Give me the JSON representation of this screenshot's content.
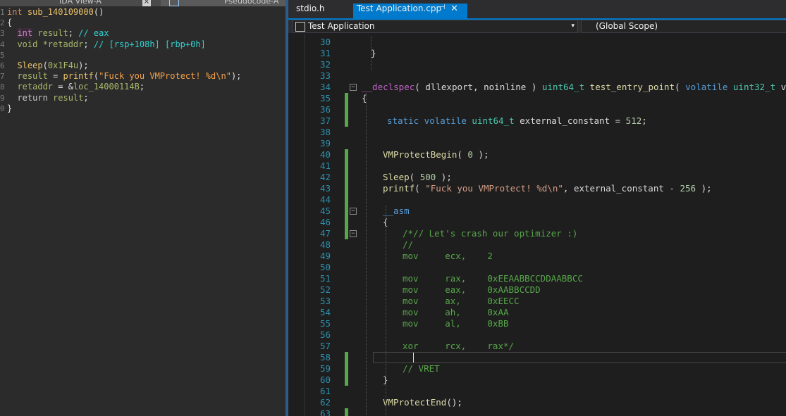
{
  "ida": {
    "tab1_label": "IDA View-A",
    "tab2_label": "Pseudocode-A",
    "close_glyph": "×",
    "lines": [
      {
        "n": "1"
      },
      {
        "n": "2"
      },
      {
        "n": "3"
      },
      {
        "n": "4"
      },
      {
        "n": "5"
      },
      {
        "n": "6"
      },
      {
        "n": "7"
      },
      {
        "n": "8"
      },
      {
        "n": "9"
      },
      {
        "n": "0"
      }
    ],
    "code": {
      "l1_kw": "int",
      "l1_fn": " sub_140109000",
      "l1_rest": "()",
      "l2": "{",
      "l3_kw": "int",
      "l3_id": " result",
      "l3_op": "; ",
      "l3_cm": "// eax",
      "l4_ty": "void",
      "l4_id": " *retaddr",
      "l4_op": "; ",
      "l4_cm": "// [rsp+108h] [rbp+0h]",
      "l5": "",
      "l6_fn": "Sleep",
      "l6_op": "(",
      "l6_num": "0x1F4u",
      "l6_end": ");",
      "l7_id": "result",
      "l7_op": " = ",
      "l7_fn": "printf",
      "l7_p": "(",
      "l7_str": "\"Fuck you VMProtect! %d\\n\"",
      "l7_end": ");",
      "l8_id": "retaddr",
      "l8_op": " = &",
      "l8_lbl": "loc_14000114B",
      "l8_end": ";",
      "l9_kw": "return",
      "l9_id": " result",
      "l9_end": ";",
      "l10": "}"
    }
  },
  "vs": {
    "tab_stdio": "stdio.h",
    "tab_active": "Test Application.cpp",
    "pin_glyph": "⊣",
    "close_glyph": "✕",
    "nav_project": "Test Application",
    "nav_scope": "(Global Scope)",
    "dropdown_glyph": "▾",
    "line_numbers": [
      "30",
      "31",
      "32",
      "33",
      "34",
      "35",
      "36",
      "37",
      "38",
      "39",
      "40",
      "41",
      "42",
      "43",
      "44",
      "45",
      "46",
      "47",
      "48",
      "49",
      "50",
      "51",
      "52",
      "53",
      "54",
      "55",
      "56",
      "57",
      "58",
      "59",
      "60",
      "61",
      "62",
      "63"
    ],
    "code": {
      "l31": "}",
      "l34_mac": "__declspec",
      "l34_a": "( ",
      "l34_b": "dllexport",
      "l34_c": ", ",
      "l34_d": "noinline",
      "l34_e": " ) ",
      "l34_t": "uint64_t",
      "l34_f": " test_entry_point",
      "l34_g": "( ",
      "l34_h": "volatile",
      "l34_i": " ",
      "l34_j": "uint32_t",
      "l34_k": " v )",
      "l35": "{",
      "l37_k1": "static",
      "l37_k2": " volatile",
      "l37_t": " uint64_t",
      "l37_id": " external_constant",
      "l37_op": " = ",
      "l37_n": "512",
      "l37_end": ";",
      "l40_fn": "VMProtectBegin",
      "l40_a": "( ",
      "l40_n": "0",
      "l40_b": " );",
      "l42_fn": "Sleep",
      "l42_a": "( ",
      "l42_n": "500",
      "l42_b": " );",
      "l43_fn": "printf",
      "l43_a": "( ",
      "l43_s": "\"Fuck you VMProtect! %d\\n\"",
      "l43_b": ", ",
      "l43_id": "external_constant",
      "l43_c": " - ",
      "l43_n": "256",
      "l43_d": " );",
      "l45": "__asm",
      "l46": "{",
      "l47": "/*// Let's crash our optimizer :)",
      "l48": "//",
      "l49": "mov     ecx,    2",
      "l51": "mov     rax,    0xEEAABBCCDDAABBCC",
      "l52": "mov     eax,    0xAABBCCDD",
      "l53": "mov     ax,     0xEECC",
      "l54": "mov     ah,     0xAA",
      "l55": "mov     al,     0xBB",
      "l57": "xor     rcx,    rax*/",
      "l59": "// VRET",
      "l60": "}",
      "l62_fn": "VMProtectEnd",
      "l62_b": "();"
    }
  }
}
